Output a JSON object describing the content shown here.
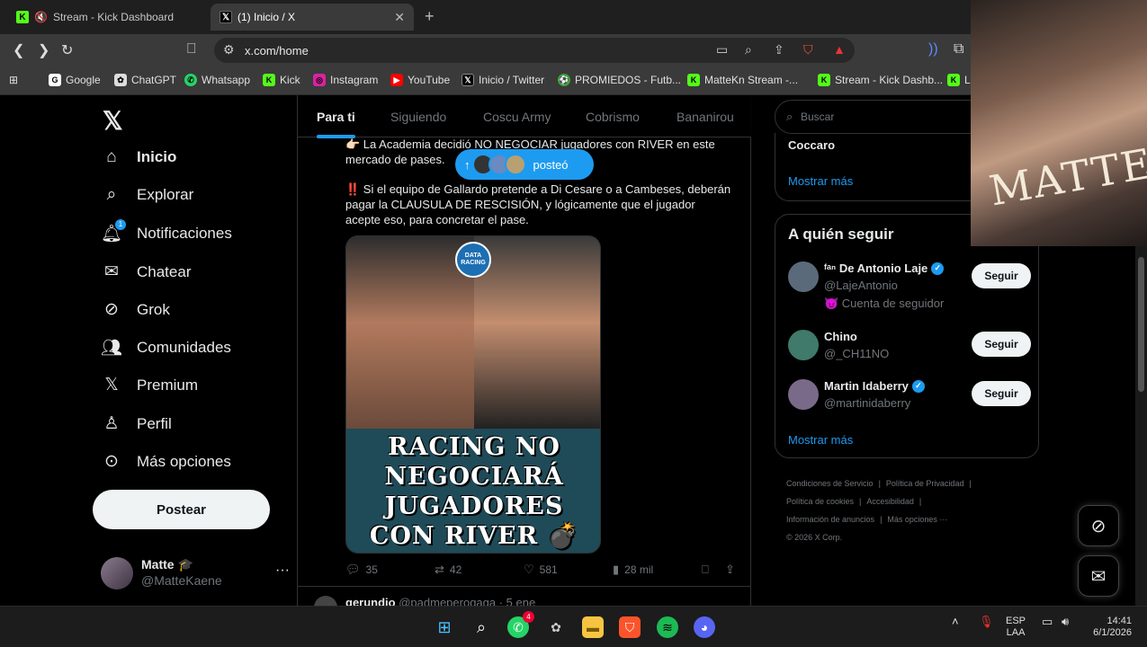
{
  "browser": {
    "tabs": [
      {
        "title": "Stream - Kick Dashboard"
      },
      {
        "title": "(1) Inicio / X"
      }
    ],
    "url": "x.com/home",
    "bookmarks": [
      "Google",
      "ChatGPT",
      "Whatsapp",
      "Kick",
      "Instagram",
      "YouTube",
      "Inicio / Twitter",
      "PROMIEDOS - Futb...",
      "MatteKn Stream -...",
      "Stream - Kick Dashb...",
      "L"
    ]
  },
  "nav": {
    "items": [
      "Inicio",
      "Explorar",
      "Notificaciones",
      "Chatear",
      "Grok",
      "Comunidades",
      "Premium",
      "Perfil",
      "Más opciones"
    ],
    "notif_count": "1",
    "post_label": "Postear",
    "user_name": "Matte 🎓",
    "user_handle": "@MatteKaene",
    "more": "···"
  },
  "feed": {
    "tabs": [
      "Para ti",
      "Siguiendo",
      "Coscu Army",
      "Cobrismo",
      "Bananirou"
    ],
    "tweet_line1": "👉🏻 La Academia decidió NO NEGOCIAR jugadores con RIVER en este mercado de pases.",
    "tweet_line2": "‼️ Si el equipo de Gallardo pretende a Di Cesare o a Cambeses, deberán pagar la CLAUSULA DE RESCISIÓN, y lógicamente que el jugador acepte eso, para concretar el pase.",
    "posted_label": "posteó",
    "image_badge": "DATA RACING",
    "headline": [
      "RACING NO",
      "NEGOCIARÁ",
      "JUGADORES",
      "CON RIVER 💣"
    ],
    "replies": "35",
    "retweets": "42",
    "likes": "581",
    "views": "28 mil",
    "next_name": "gerundio",
    "next_handle": "@padmeperogaga · 5 ene"
  },
  "right": {
    "search_placeholder": "Buscar",
    "trend_top": "Coccaro",
    "more1": "Mostrar más",
    "who_title": "A quién seguir",
    "who": [
      {
        "name": "ᶠᵃⁿ De Antonio Laje",
        "handle": "@LajeAntonio",
        "extra": "😈 Cuenta de seguidor",
        "verified": true,
        "btn": "Seguir",
        "color": "#5a6a7a"
      },
      {
        "name": "Chino",
        "handle": "@_CH11NO",
        "extra": "",
        "verified": false,
        "btn": "Seguir",
        "color": "#3f7a6a"
      },
      {
        "name": "Martin Idaberry",
        "handle": "@martinidaberry",
        "extra": "",
        "verified": true,
        "btn": "Seguir",
        "color": "#7a6a8a"
      }
    ],
    "more2": "Mostrar más",
    "footer": [
      "Condiciones de Servicio",
      "|",
      "Política de Privacidad",
      "|",
      "Política de cookies",
      "|",
      "Accesibilidad",
      "|",
      "Información de anuncios",
      "|",
      "Más opciones ···",
      "© 2026 X Corp."
    ]
  },
  "overlay": {
    "signature": "MATTE"
  },
  "taskbar": {
    "lang1": "ESP",
    "lang2": "LAA",
    "time": "14:41",
    "date": "6/1/2026",
    "whatsapp_badge": "4"
  }
}
